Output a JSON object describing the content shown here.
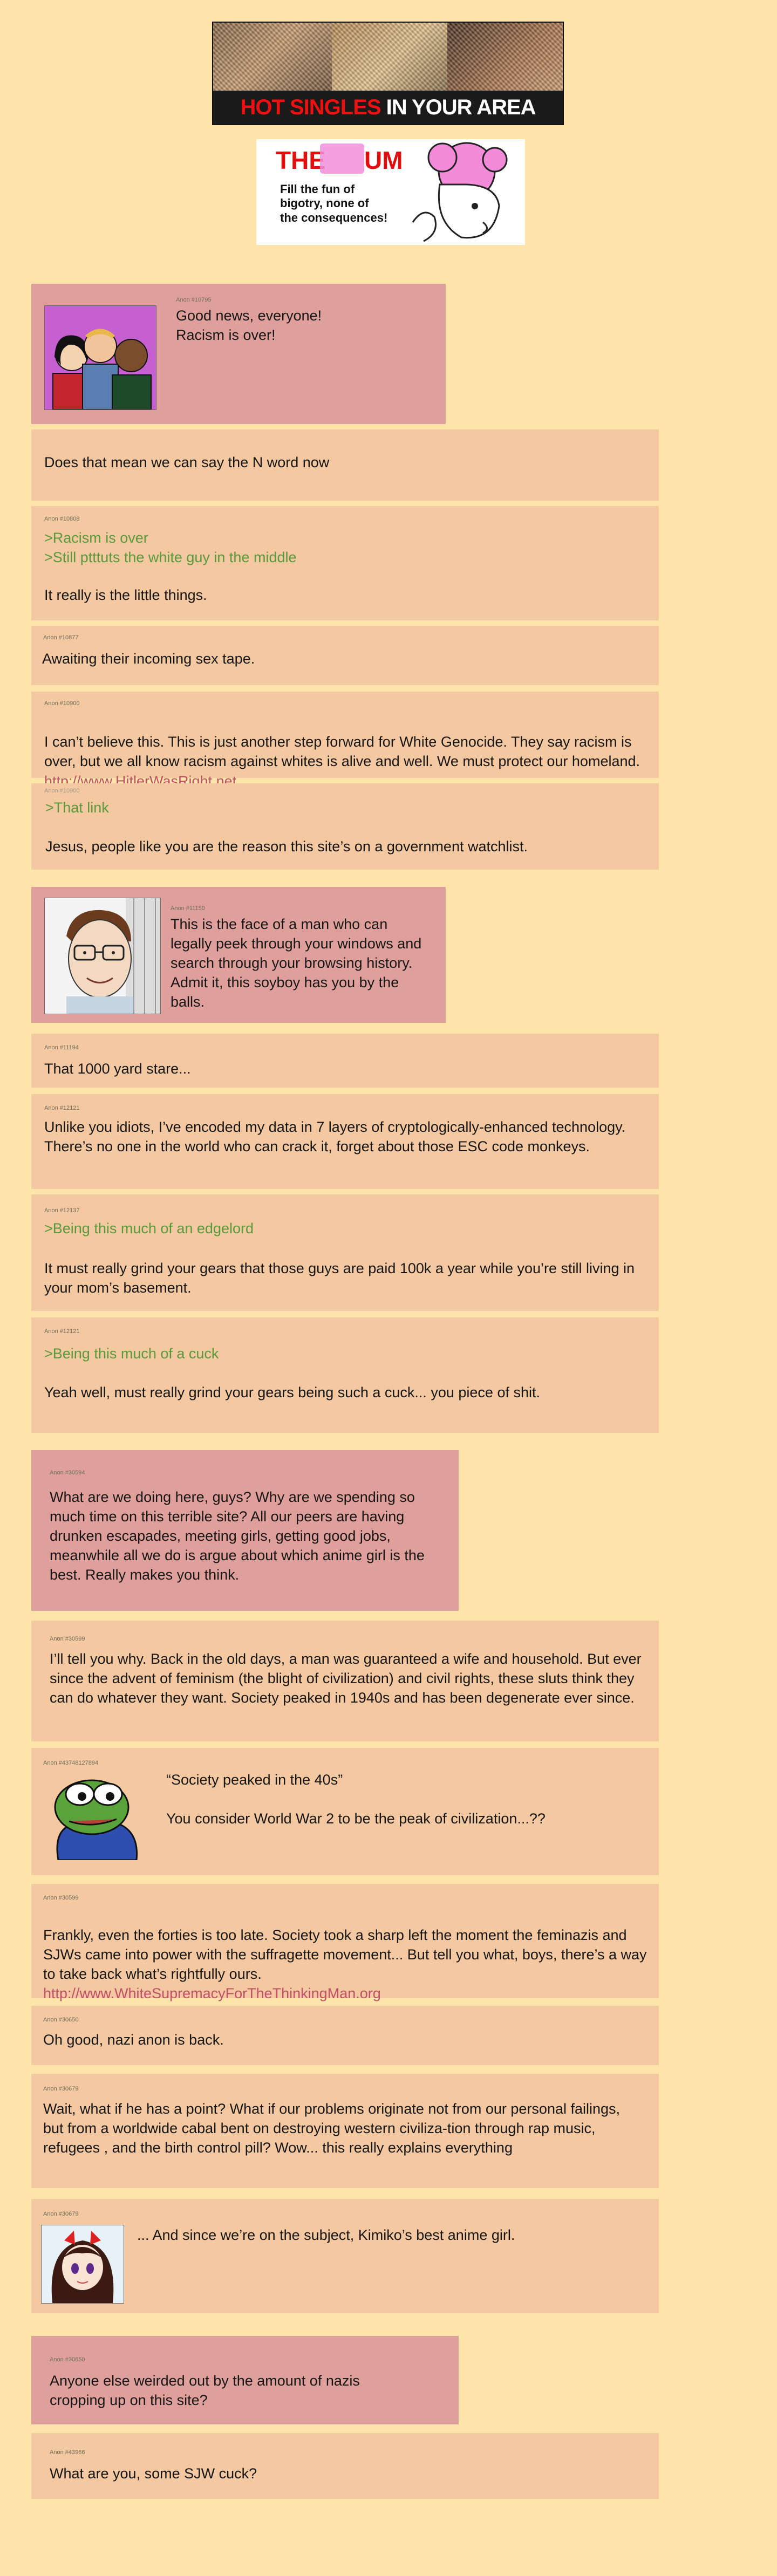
{
  "banner": {
    "hot": "HOT SINGLES",
    "rest": "IN YOUR AREA"
  },
  "logo": {
    "the": "THE",
    "um": "UM",
    "tagline": "Fill the fun of bigotry, none of the consequences!"
  },
  "colors": {
    "page_bg": "#fde5aa",
    "op_bg": "#dfa09c",
    "reply_bg": "#f4c8a0",
    "greentext": "#5a9a3c",
    "link": "#c0506a"
  },
  "threads": [
    {
      "op": {
        "id": "Anon #10795",
        "text": "Good news, everyone! Racism is over!",
        "image": "three-people-cartoon-image"
      },
      "replies": [
        {
          "id": "",
          "text": "Does that mean we can say the N word now"
        },
        {
          "id": "Anon #10808",
          "green": [
            ">Racism is over",
            ">Still ptttuts the white guy in the middle"
          ],
          "text": "It really is the little things."
        },
        {
          "id": "Anon #10877",
          "text": "Awaiting their incoming sex tape."
        },
        {
          "id": "Anon #10900",
          "text": "I can’t believe this. This is just another step forward for White Genocide. They say racism is over, but we all know racism against whites is alive and well. We must protect our homeland.",
          "link": "http://www.HitlerWasRight.net"
        },
        {
          "id": "Anon #10900",
          "green": [
            ">That link"
          ],
          "text": "Jesus, people like you are the reason this site’s on a government watchlist."
        }
      ]
    },
    {
      "op": {
        "id": "Anon #11150",
        "text": "This is the face of a man who can legally peek through your windows and search through your browsing history. Admit it, this soyboy has you by the balls.",
        "image": "soyboy-face-image"
      },
      "replies": [
        {
          "id": "Anon #11194",
          "text": "That 1000 yard stare..."
        },
        {
          "id": "Anon #12121",
          "text": "Unlike you idiots, I’ve encoded my data in 7 layers of cryptologically-enhanced technology. There’s no one in the world who can crack it, forget about those ESC code monkeys."
        },
        {
          "id": "Anon #12137",
          "green": [
            ">Being this much of an edgelord"
          ],
          "text": "It must really grind your gears that those guys are paid 100k a year while you’re still living in your mom’s basement."
        },
        {
          "id": "Anon #12121",
          "green": [
            ">Being this much of a cuck"
          ],
          "text": "Yeah well, must really grind your gears being such a cuck... you piece of shit."
        }
      ]
    },
    {
      "op": {
        "id": "Anon #30594",
        "text": "What are we doing here, guys? Why are we spending so much time on this terrible site? All our peers are having drunken escapades, meeting girls, getting good jobs, meanwhile all we do is argue about which anime girl is the best. Really makes you think."
      },
      "replies": [
        {
          "id": "Anon #30599",
          "text": "I’ll tell you why. Back in the old days, a man was guaranteed a wife and household. But ever since the advent of feminism (the blight of civilization) and civil rights, these sluts think they can do whatever they want. Society peaked in 1940s and has been degenerate ever since."
        },
        {
          "id": "Anon #43748127894",
          "text": "“Society peaked in the 40s”\n\nYou consider World War 2 to be the peak of civilization...??",
          "image": "pepe-frog-image"
        },
        {
          "id": "Anon #30599",
          "text": "Frankly, even the forties is too late. Society took a sharp left the moment the feminazis and SJWs came into power with the suffragette movement... But tell you what, boys, there’s a way to take back what’s rightfully ours.",
          "link": "http://www.WhiteSupremacyForTheThinkingMan.org"
        },
        {
          "id": "Anon #30650",
          "text": "Oh good, nazi anon is back."
        },
        {
          "id": "Anon #30679",
          "text": "Wait, what if he has a point? What if our problems originate not from our personal failings, but from a worldwide cabal bent on destroying western civiliza-tion through rap music, refugees , and the birth control pill? Wow... this really explains everything"
        },
        {
          "id": "Anon #30679",
          "text": "... And since we’re on the subject, Kimiko’s best anime girl.",
          "image": "anime-girl-image"
        }
      ]
    },
    {
      "op": {
        "id": "Anon #30650",
        "text": "Anyone else weirded out by the amount of nazis cropping up on this site?"
      },
      "replies": [
        {
          "id": "Anon #43966",
          "text": "What are you, some SJW cuck?"
        }
      ]
    }
  ]
}
